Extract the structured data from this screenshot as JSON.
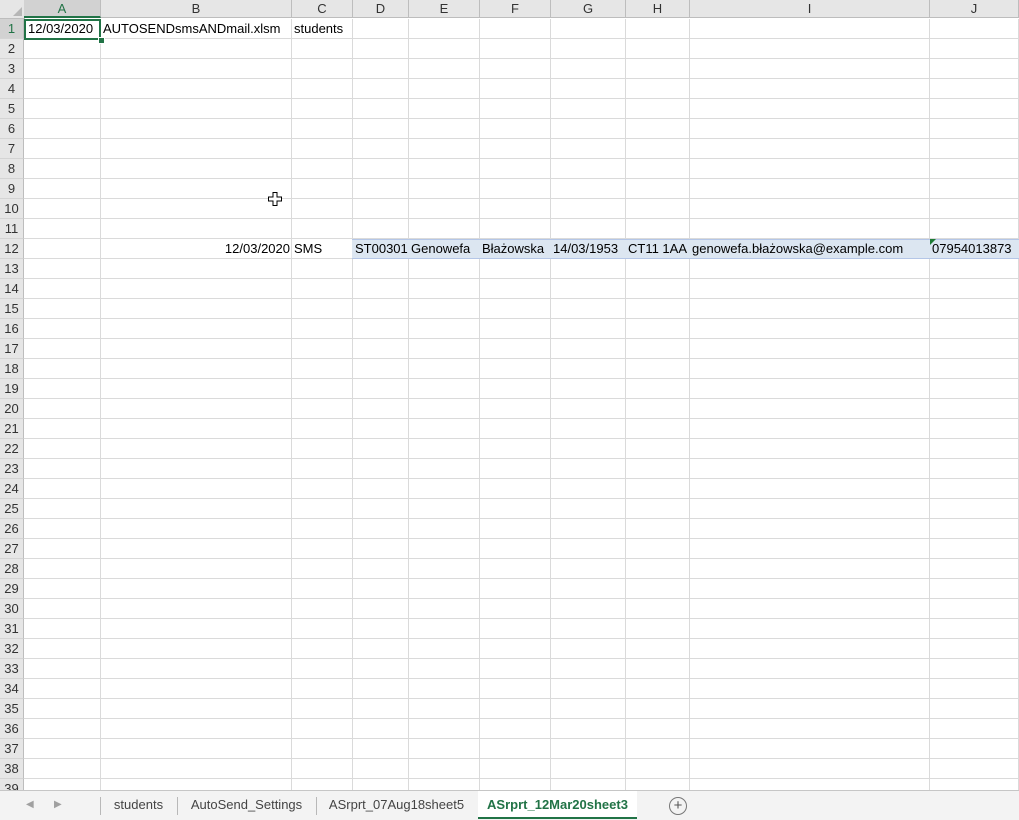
{
  "columns": [
    "A",
    "B",
    "C",
    "D",
    "E",
    "F",
    "G",
    "H",
    "I",
    "J"
  ],
  "selected_column": "A",
  "rows": [
    "1",
    "2",
    "3",
    "4",
    "5",
    "6",
    "7",
    "8",
    "9",
    "10",
    "11",
    "12",
    "13",
    "14",
    "15",
    "16",
    "17",
    "18",
    "19",
    "20",
    "21",
    "22",
    "23",
    "24",
    "25",
    "26",
    "27",
    "28",
    "29",
    "30",
    "31",
    "32",
    "33",
    "34",
    "35",
    "36",
    "37",
    "38",
    "39"
  ],
  "selected_row": "1",
  "row1": {
    "a": "12/03/2020",
    "b": "AUTOSENDsmsANDmail.xlsm",
    "c": "students"
  },
  "row12": {
    "b": "12/03/2020",
    "c": "SMS",
    "d": "ST00301",
    "e": "Genowefa",
    "f": "Błażowska",
    "g": "14/03/1953",
    "h": "CT11 1AA",
    "i": "genowefa.błażowska@example.com",
    "j": "07954013873"
  },
  "tabs": [
    "students",
    "AutoSend_Settings",
    "ASrprt_07Aug18sheet5",
    "ASrprt_12Mar20sheet3"
  ],
  "active_tab": "ASrprt_12Mar20sheet3",
  "add_sheet_icon": "+",
  "colors": {
    "accent": "#217346",
    "row_highlight": "#dce6f1"
  }
}
